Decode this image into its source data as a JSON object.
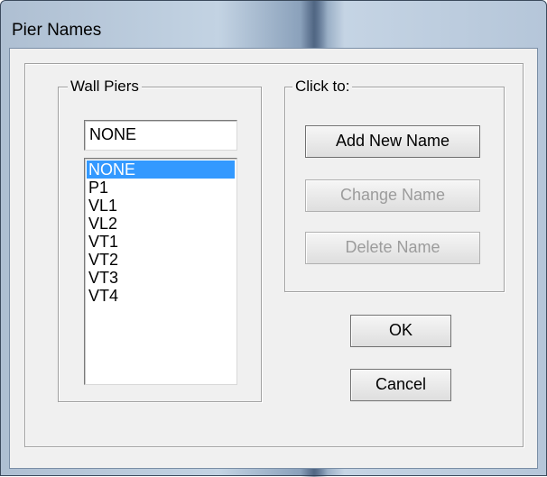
{
  "window": {
    "title": "Pier Names"
  },
  "wall_piers": {
    "group_label": "Wall Piers",
    "name_value": "NONE",
    "items": [
      "NONE",
      "P1",
      "VL1",
      "VL2",
      "VT1",
      "VT2",
      "VT3",
      "VT4"
    ],
    "selected_index": 0
  },
  "click_to": {
    "group_label": "Click to:",
    "add_label": "Add New Name",
    "change_label": "Change Name",
    "delete_label": "Delete Name"
  },
  "buttons": {
    "ok_label": "OK",
    "cancel_label": "Cancel"
  }
}
